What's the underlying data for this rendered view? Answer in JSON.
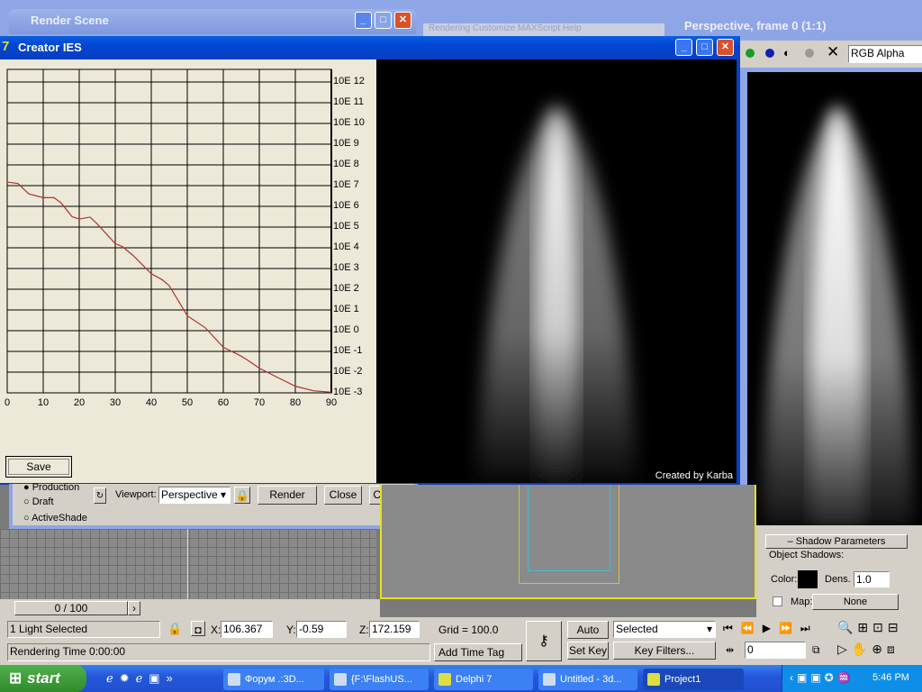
{
  "background_windows": {
    "render_scene": {
      "title": "Render Scene",
      "menu_ghost": "Rendering   Customize   MAXScript   Help",
      "radios": [
        "Production",
        "Draft",
        "ActiveShade"
      ],
      "selected_radio": "Production",
      "viewport_label": "Viewport:",
      "viewport_value": "Perspective",
      "buttons": {
        "render": "Render",
        "close": "Close",
        "cancel": "Cancel"
      }
    },
    "frame_window": {
      "title": "Perspective, frame 0 (1:1)",
      "channel": "RGB Alpha"
    }
  },
  "creator": {
    "title": "Creator IES",
    "save": "Save",
    "credit": "Created by Karba"
  },
  "chart_data": {
    "type": "line",
    "title": "",
    "xlabel": "",
    "ylabel": "",
    "log_y": true,
    "grid": true,
    "xlim": [
      0,
      90
    ],
    "ylim_exponent": [
      -3,
      12
    ],
    "x_ticks": [
      "0",
      "10",
      "20",
      "30",
      "40",
      "50",
      "60",
      "70",
      "80",
      "90"
    ],
    "y_ticks": [
      "10E 12",
      "10E 11",
      "10E 10",
      "10E 9",
      "10E 8",
      "10E 7",
      "10E 6",
      "10E 5",
      "10E 4",
      "10E 3",
      "10E 2",
      "10E 1",
      "10E 0",
      "10E -1",
      "10E -2",
      "10E -3"
    ],
    "series": [
      {
        "color": "#b03030",
        "x": [
          0,
          3,
          6,
          10,
          13,
          15,
          18,
          20,
          23,
          25,
          30,
          32,
          35,
          40,
          43,
          45,
          48,
          50,
          55,
          60,
          65,
          67,
          70,
          75,
          80,
          85,
          90
        ],
        "log10_y": [
          7.17,
          7.1,
          6.6,
          6.42,
          6.42,
          6.16,
          5.5,
          5.39,
          5.48,
          5.15,
          4.2,
          4.06,
          3.62,
          2.75,
          2.46,
          2.17,
          1.3,
          0.72,
          0.14,
          -0.8,
          -1.23,
          -1.45,
          -1.81,
          -2.25,
          -2.68,
          -2.9,
          -2.97
        ]
      }
    ]
  },
  "command_panel": {
    "rollout": "Shadow Parameters",
    "group": "Object Shadows:",
    "color_label": "Color:",
    "dens_label": "Dens.",
    "dens_value": "1.0",
    "map_label": "Map:",
    "map_value": "None"
  },
  "viewport_nav": {
    "time": "0 / 100"
  },
  "status": {
    "selection": "1 Light Selected",
    "rendering_time": "Rendering Time  0:00:00",
    "x_label": "X:",
    "x": "106.367",
    "y_label": "Y:",
    "y": "-0.59",
    "z_label": "Z:",
    "z": "172.159",
    "grid": "Grid = 100.0",
    "add_time_tag": "Add Time Tag",
    "auto_key": "Auto Key",
    "set_key": "Set Key",
    "selected": "Selected",
    "key_filters": "Key Filters...",
    "frame": "0"
  },
  "taskbar": {
    "start": "start",
    "items": [
      "Форум .:3D...",
      "{F:\\FlashUS...",
      "Delphi 7",
      "Untitled - 3d...",
      "Project1"
    ],
    "clock": "5:46 PM"
  }
}
